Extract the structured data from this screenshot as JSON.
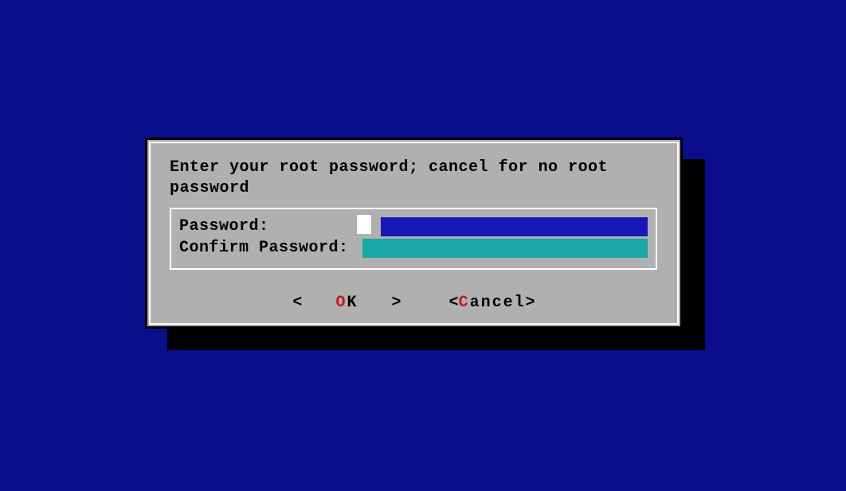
{
  "dialog": {
    "prompt": "Enter your root password; cancel for no root password",
    "fields": {
      "password": {
        "label": "Password:",
        "value": ""
      },
      "confirm": {
        "label": "Confirm Password:",
        "value": ""
      }
    },
    "buttons": {
      "ok": {
        "open": "<",
        "hotkey": "O",
        "rest": "K",
        "close": ">"
      },
      "cancel": {
        "open": "<",
        "hotkey": "C",
        "rest": "ancel",
        "close": ">"
      }
    }
  },
  "colors": {
    "background": "#0a0e8a",
    "dialog_bg": "#b0b0b0",
    "password_field": "#1818b8",
    "confirm_field": "#18a8a8",
    "hotkey": "#c81818"
  }
}
